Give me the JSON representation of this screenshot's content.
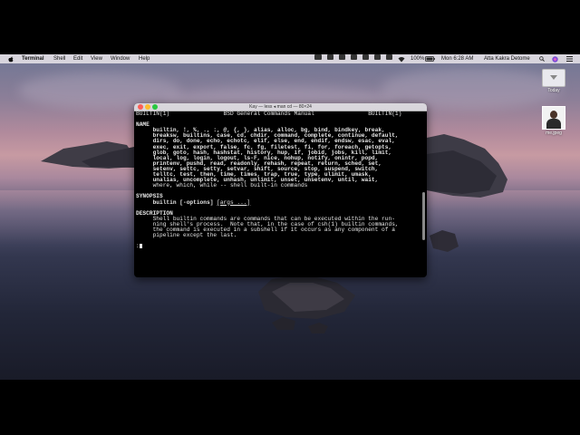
{
  "menubar": {
    "apple": "",
    "app": "Terminal",
    "items": [
      "Shell",
      "Edit",
      "View",
      "Window",
      "Help"
    ],
    "battery": "100%",
    "clock": "Mon 6:28 AM",
    "user": "Atta Kakra Detome"
  },
  "window": {
    "title": "Kay — less ◂ man cd — 80×24"
  },
  "terminal": {
    "header": "BUILTIN(1)                BSD General Commands Manual                BUILTIN(1)",
    "blank1": "",
    "name_heading": "NAME",
    "name_lines": [
      "     builtin, !, %, ., :, @, {, }, alias, alloc, bg, bind, bindkey, break,",
      "     breaksw, builtins, case, cd, chdir, command, complete, continue, default,",
      "     dirs, do, done, echo, echotc, elif, else, end, endif, endsw, esac, eval,",
      "     exec, exit, export, false, fc, fg, filetest, fi, for, foreach, getopts,",
      "     glob, goto, hash, hashstat, history, hup, if, jobid, jobs, kill, limit,",
      "     local, log, login, logout, ls-F, nice, nohup, notify, onintr, popd,",
      "     printenv, pushd, read, readonly, rehash, repeat, return, sched, set,",
      "     setenv, settc, setty, setvar, shift, source, stop, suspend, switch,",
      "     telltc, test, then, time, times, trap, true, type, ulimit, umask,",
      "     unalias, uncomplete, unhash, unlimit, unset, unsetenv, until, wait,",
      "     where, which, while -- shell built-in commands"
    ],
    "synopsis_heading": "SYNOPSIS",
    "synopsis_cmd": "     builtin [-options] ",
    "synopsis_args": "[args ...]",
    "description_heading": "DESCRIPTION",
    "description_lines": [
      "     Shell builtin commands are commands that can be executed within the run-",
      "     ning shell's process.  Note that, in the case of csh(1) builtin commands,",
      "     the command is executed in a subshell if it occurs as any component of a",
      "     pipeline except the last."
    ],
    "prompt": ":"
  },
  "desktop": {
    "today_label": "Today",
    "photo_label": "me.jpeg"
  },
  "colors": {
    "close": "#fc5f57",
    "minimize": "#fdbc2e",
    "zoom": "#28c840"
  }
}
